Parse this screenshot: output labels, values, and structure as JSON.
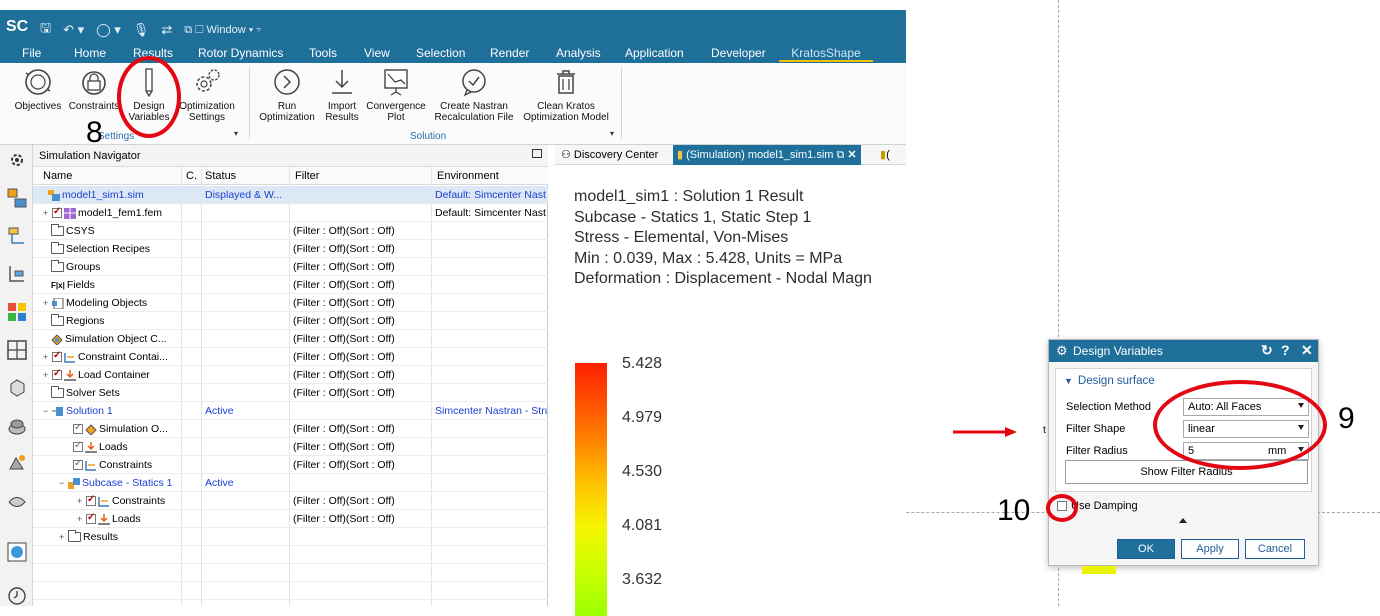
{
  "app": {
    "logo": "SC",
    "qat_window_label": "Window"
  },
  "tabs": [
    "File",
    "Home",
    "Results",
    "Rotor Dynamics",
    "Tools",
    "View",
    "Selection",
    "Render",
    "Analysis",
    "Application",
    "Developer",
    "KratosShape"
  ],
  "ribbon": {
    "settings_group": {
      "label": "Settings",
      "buttons": [
        "Objectives",
        "Constraints",
        "Design\nVariables",
        "Optimization\nSettings"
      ]
    },
    "solution_group": {
      "label": "Solution",
      "buttons": [
        "Run\nOptimization",
        "Import\nResults",
        "Convergence\nPlot",
        "Create Nastran\nRecalculation File",
        "Clean Kratos\nOptimization Model"
      ]
    }
  },
  "navigator": {
    "title": "Simulation Navigator",
    "columns": [
      "Name",
      "C.",
      "Status",
      "Filter",
      "Environment"
    ],
    "rows": [
      {
        "name": "model1_sim1.sim",
        "status": "Displayed & W...",
        "filter": "",
        "env": "Default: Simcenter Nast"
      },
      {
        "name": "model1_fem1.fem",
        "status": "",
        "filter": "",
        "env": "Default: Simcenter Nast"
      },
      {
        "name": "CSYS",
        "status": "",
        "filter": "(Filter : Off)(Sort : Off)",
        "env": ""
      },
      {
        "name": "Selection Recipes",
        "status": "",
        "filter": "(Filter : Off)(Sort : Off)",
        "env": ""
      },
      {
        "name": "Groups",
        "status": "",
        "filter": "(Filter : Off)(Sort : Off)",
        "env": ""
      },
      {
        "name": "Fields",
        "status": "",
        "filter": "(Filter : Off)(Sort : Off)",
        "env": ""
      },
      {
        "name": "Modeling Objects",
        "status": "",
        "filter": "(Filter : Off)(Sort : Off)",
        "env": ""
      },
      {
        "name": "Regions",
        "status": "",
        "filter": "(Filter : Off)(Sort : Off)",
        "env": ""
      },
      {
        "name": "Simulation Object C...",
        "status": "",
        "filter": "(Filter : Off)(Sort : Off)",
        "env": ""
      },
      {
        "name": "Constraint Contai...",
        "status": "",
        "filter": "(Filter : Off)(Sort : Off)",
        "env": ""
      },
      {
        "name": "Load Container",
        "status": "",
        "filter": "(Filter : Off)(Sort : Off)",
        "env": ""
      },
      {
        "name": "Solver Sets",
        "status": "",
        "filter": "(Filter : Off)(Sort : Off)",
        "env": ""
      },
      {
        "name": "Solution 1",
        "status": "Active",
        "filter": "",
        "env": "Simcenter Nastran - Stru"
      },
      {
        "name": "Simulation O...",
        "status": "",
        "filter": "(Filter : Off)(Sort : Off)",
        "env": ""
      },
      {
        "name": "Loads",
        "status": "",
        "filter": "(Filter : Off)(Sort : Off)",
        "env": ""
      },
      {
        "name": "Constraints",
        "status": "",
        "filter": "(Filter : Off)(Sort : Off)",
        "env": ""
      },
      {
        "name": "Subcase - Statics 1",
        "status": "Active",
        "filter": "",
        "env": ""
      },
      {
        "name": "Constraints",
        "status": "",
        "filter": "(Filter : Off)(Sort : Off)",
        "env": ""
      },
      {
        "name": "Loads",
        "status": "",
        "filter": "(Filter : Off)(Sort : Off)",
        "env": ""
      },
      {
        "name": "Results",
        "status": "",
        "filter": "",
        "env": ""
      }
    ]
  },
  "graphics": {
    "tabs": [
      "Discovery Center",
      "(Simulation) model1_sim1.sim",
      "("
    ],
    "result_lines": [
      "model1_sim1 : Solution 1 Result",
      "Subcase - Statics 1, Static Step 1",
      "Stress - Elemental, Von-Mises",
      "Min : 0.039, Max : 5.428, Units = MPa",
      "Deformation : Displacement - Nodal Magn"
    ],
    "legend_values": [
      "5.428",
      "4.979",
      "4.530",
      "4.081",
      "3.632"
    ]
  },
  "dialog": {
    "title": "Design Variables",
    "section": "Design surface",
    "selection_method_label": "Selection Method",
    "selection_method_value": "Auto: All Faces",
    "filter_shape_label": "Filter Shape",
    "filter_shape_value": "linear",
    "filter_radius_label": "Filter Radius",
    "filter_radius_value": "5",
    "filter_radius_unit": "mm",
    "show_button": "Show Filter Radius",
    "damping_label": "Use Damping",
    "ok": "OK",
    "apply": "Apply",
    "cancel": "Cancel"
  },
  "annotations": [
    "8",
    "9",
    "10"
  ],
  "colors": {
    "brand": "#1f6f9b",
    "annotation_red": "#e30613",
    "link_blue": "#1a3fd0"
  }
}
